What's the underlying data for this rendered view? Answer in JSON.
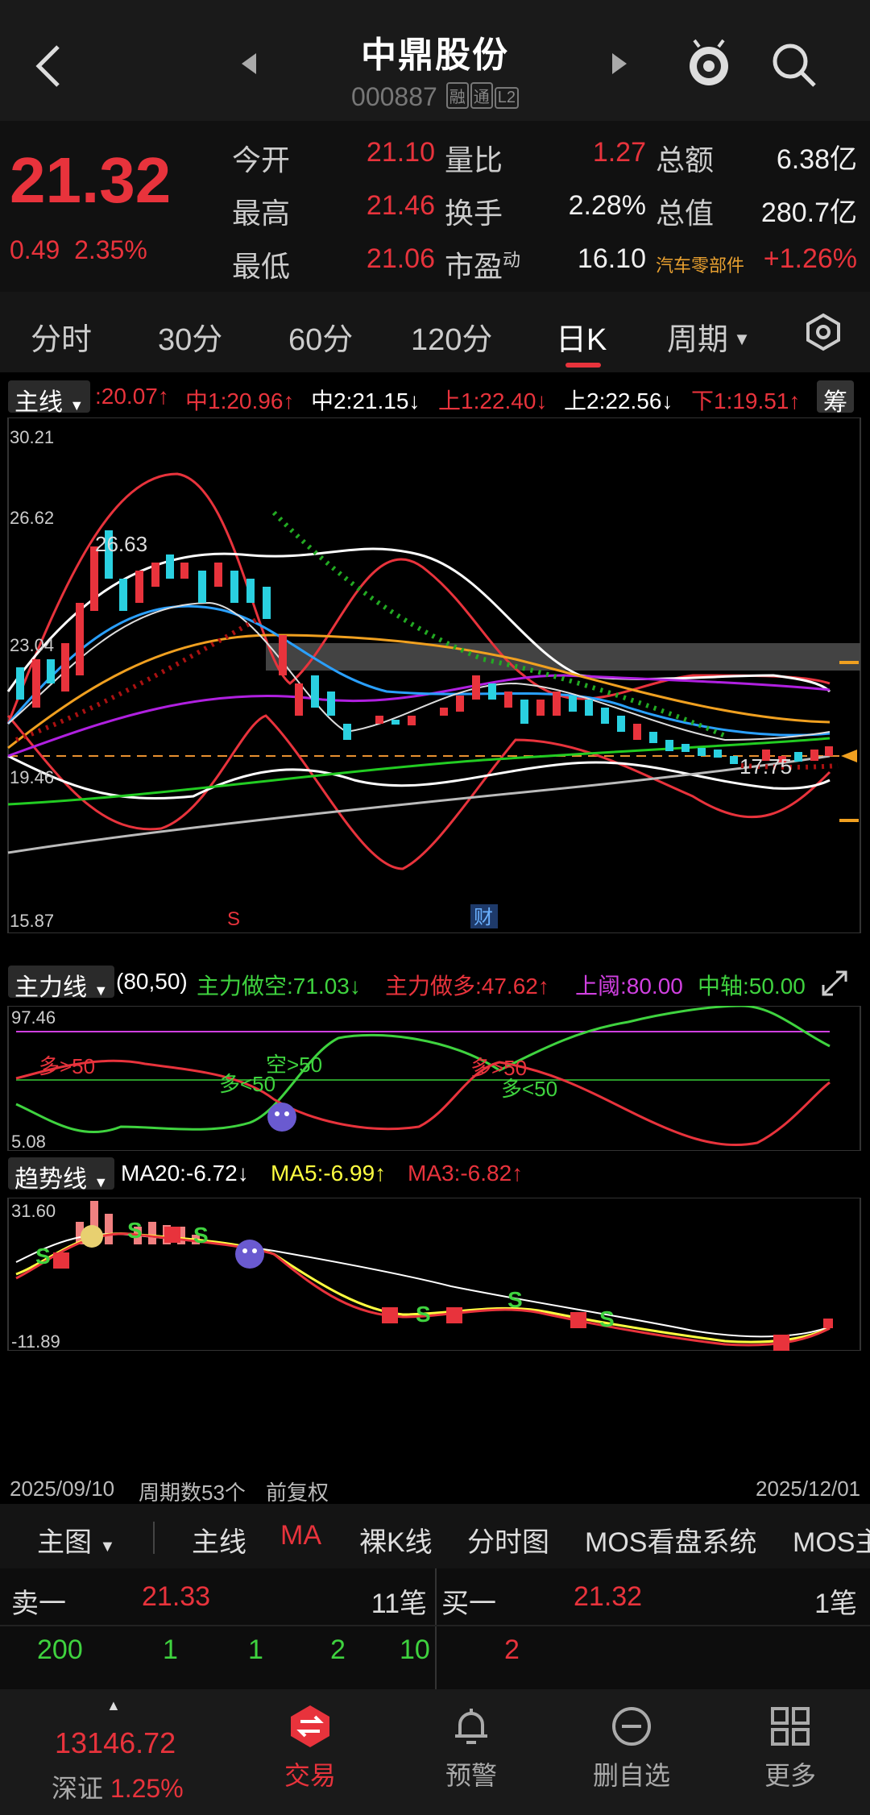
{
  "header": {
    "title": "中鼎股份",
    "code": "000887",
    "tags": [
      "融",
      "通",
      "L2"
    ]
  },
  "quote": {
    "price": "21.32",
    "change": "0.49",
    "change_pct": "2.35%",
    "rows": [
      {
        "l1": "今开",
        "v1": "21.10",
        "l2": "量比",
        "v2": "1.27",
        "l3": "总额",
        "v3": "6.38亿"
      },
      {
        "l1": "最高",
        "v1": "21.46",
        "l2": "换手",
        "v2": "2.28%",
        "l3": "总值",
        "v3": "280.7亿"
      },
      {
        "l1": "最低",
        "v1": "21.06",
        "l2": "市盈",
        "l2sup": "动",
        "v2": "16.10",
        "l3": "汽车零部件",
        "v3": "+1.26%"
      }
    ]
  },
  "period_tabs": [
    "分时",
    "30分",
    "60分",
    "120分",
    "日K",
    "周期"
  ],
  "active_tab": "日K",
  "main_chart": {
    "button": "主线",
    "legend": [
      {
        "text": ":20.07↑",
        "color": "#e8333c"
      },
      {
        "text": "中1:20.96↑",
        "color": "#e8333c"
      },
      {
        "text": "中2:21.15↓",
        "color": "#ffffff"
      },
      {
        "text": "上1:22.40↓",
        "color": "#e8333c"
      },
      {
        "text": "上2:22.56↓",
        "color": "#ffffff"
      },
      {
        "text": "下1:19.51↑",
        "color": "#e8333c"
      }
    ],
    "chip_button": "筹",
    "y_labels": [
      "30.21",
      "26.62",
      "23.04",
      "19.46",
      "15.87"
    ],
    "annotations": {
      "high": "26.63",
      "low": "17.75",
      "s_mark": "S",
      "cai_mark": "财"
    }
  },
  "indicator1": {
    "button": "主力线",
    "params": "(80,50)",
    "legend": [
      {
        "text": "主力做空:71.03↓",
        "color": "#3fd33f"
      },
      {
        "text": "主力做多:47.62↑",
        "color": "#e8333c"
      },
      {
        "text": "上阈:80.00",
        "color": "#d040e0"
      },
      {
        "text": "中轴:50.00",
        "color": "#3fd33f"
      }
    ],
    "y_labels": [
      "97.46",
      "5.08"
    ],
    "annotations": [
      "多>50",
      "多<50",
      "空>50",
      "多>50",
      "多<50"
    ]
  },
  "indicator2": {
    "button": "趋势线",
    "legend": [
      {
        "text": "MA20:-6.72↓",
        "color": "#ffffff"
      },
      {
        "text": "MA5:-6.99↑",
        "color": "#ffff40"
      },
      {
        "text": "MA3:-6.82↑",
        "color": "#e8333c"
      }
    ],
    "y_labels": [
      "31.60",
      "-11.89"
    ]
  },
  "footer_info": {
    "start_date": "2025/09/10",
    "period_count": "周期数53个",
    "adjust": "前复权",
    "end_date": "2025/12/01"
  },
  "sub_tabs": [
    "主图",
    "主线",
    "MA",
    "裸K线",
    "分时图",
    "MOS看盘系统",
    "MOS主"
  ],
  "order_book": {
    "sell_label": "卖一",
    "sell_price": "21.33",
    "sell_count": "11笔",
    "buy_label": "买一",
    "buy_price": "21.32",
    "buy_count": "1笔",
    "sell_vols": [
      "200",
      "1",
      "1",
      "2",
      "10"
    ],
    "buy_vols": [
      "2"
    ]
  },
  "bottom_nav": {
    "index_value": "13146.72",
    "index_name": "深证",
    "index_pct": "1.25%",
    "items": [
      "交易",
      "预警",
      "删自选",
      "更多"
    ]
  },
  "colors": {
    "up": "#e8333c",
    "down": "#3fd33f",
    "accent": "#e8333c"
  }
}
